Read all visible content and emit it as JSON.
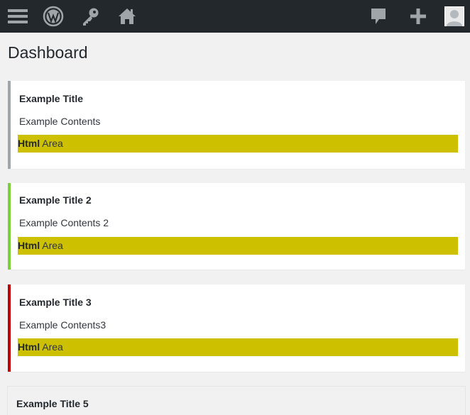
{
  "adminbar": {
    "bg": "#23282d",
    "icons": [
      "menu-icon",
      "wordpress-icon",
      "key-icon",
      "home-icon",
      "comment-icon",
      "plus-icon",
      "avatar"
    ]
  },
  "page": {
    "title": "Dashboard"
  },
  "cards": [
    {
      "title": "Example Title",
      "content": "Example Contents",
      "html_bold": "Html",
      "html_rest": " Area",
      "accent": "#a0a5aa"
    },
    {
      "title": "Example Title 2",
      "content": "Example Contents 2",
      "html_bold": "Html",
      "html_rest": " Area",
      "accent": "#7ad03a"
    },
    {
      "title": "Example Title 3",
      "content": "Example Contents3",
      "html_bold": "Html",
      "html_rest": " Area",
      "accent": "#c00000"
    },
    {
      "title": "Example Title 5"
    }
  ],
  "colors": {
    "html_area": "#ccc000",
    "background": "#f1f1f1"
  }
}
